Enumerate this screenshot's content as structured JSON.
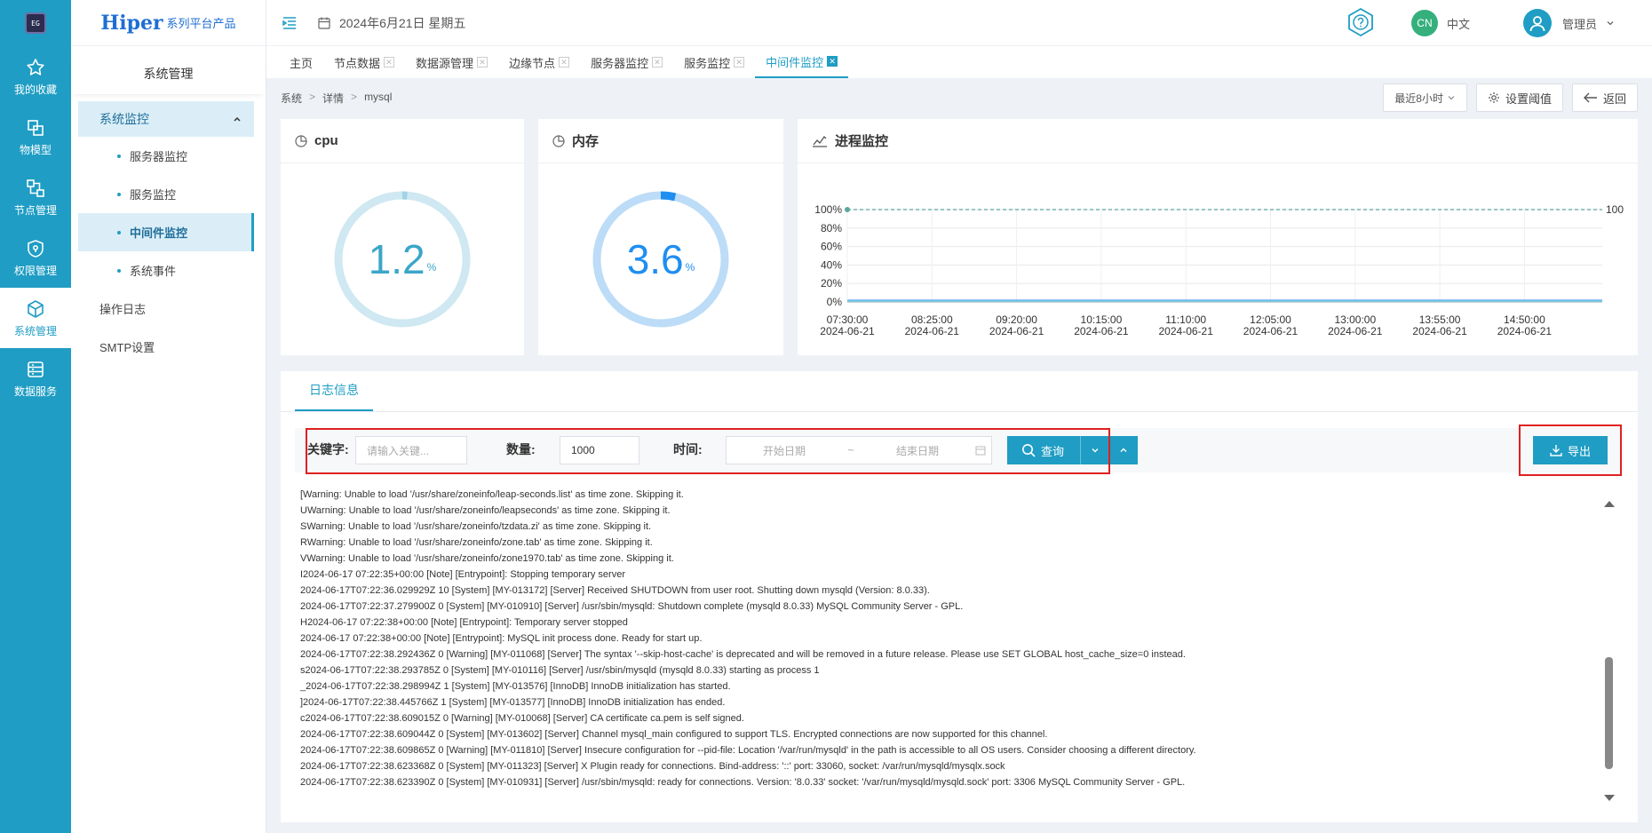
{
  "rail": {
    "logo": "EG",
    "items": [
      {
        "label": "我的收藏",
        "icon": "star-icon"
      },
      {
        "label": "物模型",
        "icon": "model-icon"
      },
      {
        "label": "节点管理",
        "icon": "node-icon"
      },
      {
        "label": "权限管理",
        "icon": "shield-icon"
      },
      {
        "label": "系统管理",
        "icon": "cube-icon",
        "active": true
      },
      {
        "label": "数据服务",
        "icon": "database-icon"
      }
    ]
  },
  "brand": {
    "name": "Hiper",
    "tagline": "系列平台产品"
  },
  "side": {
    "title": "系统管理",
    "group": "系统监控",
    "sub_items": [
      "服务器监控",
      "服务监控",
      "中间件监控",
      "系统事件"
    ],
    "active_sub": "中间件监控",
    "top_items": [
      "操作日志",
      "SMTP设置"
    ]
  },
  "header": {
    "date": "2024年6月21日 星期五",
    "lang_badge": "CN",
    "lang_label": "中文",
    "user_name": "管理员"
  },
  "tabs": [
    {
      "label": "主页",
      "closable": false
    },
    {
      "label": "节点数据",
      "closable": true
    },
    {
      "label": "数据源管理",
      "closable": true
    },
    {
      "label": "边缘节点",
      "closable": true
    },
    {
      "label": "服务器监控",
      "closable": true
    },
    {
      "label": "服务监控",
      "closable": true
    },
    {
      "label": "中间件监控",
      "closable": true,
      "active": true
    }
  ],
  "breadcrumb": [
    "系统",
    "详情",
    "mysql"
  ],
  "actions": {
    "range": "最近8小时",
    "threshold": "设置阈值",
    "back": "返回"
  },
  "cpu": {
    "title": "cpu",
    "value": "1.2",
    "unit": "%",
    "percent": 1.2,
    "color": "#9fd3e6",
    "track": "#cfe8f2",
    "text_color": "#3aa6c8"
  },
  "memory": {
    "title": "内存",
    "value": "3.6",
    "unit": "%",
    "percent": 3.6,
    "color": "#1f8ef1",
    "track": "#bcdcf7",
    "text_color": "#1f8ef1"
  },
  "process": {
    "title": "进程监控"
  },
  "chart_data": {
    "type": "line",
    "y_ticks": [
      "100%",
      "80%",
      "60%",
      "40%",
      "20%",
      "0%"
    ],
    "ylim": [
      0,
      100
    ],
    "x_ticks": [
      {
        "time": "07:30:00",
        "date": "2024-06-21"
      },
      {
        "time": "08:25:00",
        "date": "2024-06-21"
      },
      {
        "time": "09:20:00",
        "date": "2024-06-21"
      },
      {
        "time": "10:15:00",
        "date": "2024-06-21"
      },
      {
        "time": "11:10:00",
        "date": "2024-06-21"
      },
      {
        "time": "12:05:00",
        "date": "2024-06-21"
      },
      {
        "time": "13:00:00",
        "date": "2024-06-21"
      },
      {
        "time": "13:55:00",
        "date": "2024-06-21"
      },
      {
        "time": "14:50:00",
        "date": "2024-06-21"
      }
    ],
    "series": [
      {
        "values": [
          100,
          100
        ],
        "dashed": true,
        "color": "#5aa89c",
        "end_label": "100"
      },
      {
        "values": [
          1.5,
          1.5
        ],
        "color": "#1f8ef1"
      },
      {
        "values": [
          0.8,
          0.8
        ],
        "color": "#7fc9e0"
      }
    ],
    "grid": true
  },
  "log": {
    "tab": "日志信息",
    "keyword_label": "关键字:",
    "keyword_placeholder": "请输入关键...",
    "count_label": "数量:",
    "count_value": "1000",
    "time_label": "时间:",
    "start_placeholder": "开始日期",
    "range_sep": "~",
    "end_placeholder": "结束日期",
    "query": "查询",
    "export": "导出",
    "lines": [
      "[Warning: Unable to load '/usr/share/zoneinfo/leap-seconds.list' as time zone. Skipping it.",
      "UWarning: Unable to load '/usr/share/zoneinfo/leapseconds' as time zone. Skipping it.",
      "SWarning: Unable to load '/usr/share/zoneinfo/tzdata.zi' as time zone. Skipping it.",
      "RWarning: Unable to load '/usr/share/zoneinfo/zone.tab' as time zone. Skipping it.",
      "VWarning: Unable to load '/usr/share/zoneinfo/zone1970.tab' as time zone. Skipping it.",
      "I2024-06-17 07:22:35+00:00 [Note] [Entrypoint]: Stopping temporary server",
      "2024-06-17T07:22:36.029929Z 10 [System] [MY-013172] [Server] Received SHUTDOWN from user root. Shutting down mysqld (Version: 8.0.33).",
      "2024-06-17T07:22:37.279900Z 0 [System] [MY-010910] [Server] /usr/sbin/mysqld: Shutdown complete (mysqld 8.0.33) MySQL Community Server - GPL.",
      "H2024-06-17 07:22:38+00:00 [Note] [Entrypoint]: Temporary server stopped",
      "2024-06-17 07:22:38+00:00 [Note] [Entrypoint]: MySQL init process done. Ready for start up.",
      "2024-06-17T07:22:38.292436Z 0 [Warning] [MY-011068] [Server] The syntax '--skip-host-cache' is deprecated and will be removed in a future release. Please use SET GLOBAL host_cache_size=0 instead.",
      "s2024-06-17T07:22:38.293785Z 0 [System] [MY-010116] [Server] /usr/sbin/mysqld (mysqld 8.0.33) starting as process 1",
      "_2024-06-17T07:22:38.298994Z 1 [System] [MY-013576] [InnoDB] InnoDB initialization has started.",
      "]2024-06-17T07:22:38.445766Z 1 [System] [MY-013577] [InnoDB] InnoDB initialization has ended.",
      "c2024-06-17T07:22:38.609015Z 0 [Warning] [MY-010068] [Server] CA certificate ca.pem is self signed.",
      "2024-06-17T07:22:38.609044Z 0 [System] [MY-013602] [Server] Channel mysql_main configured to support TLS. Encrypted connections are now supported for this channel.",
      "2024-06-17T07:22:38.609865Z 0 [Warning] [MY-011810] [Server] Insecure configuration for --pid-file: Location '/var/run/mysqld' in the path is accessible to all OS users. Consider choosing a different directory.",
      "2024-06-17T07:22:38.623368Z 0 [System] [MY-011323] [Server] X Plugin ready for connections. Bind-address: '::' port: 33060, socket: /var/run/mysqld/mysqlx.sock",
      "2024-06-17T07:22:38.623390Z 0 [System] [MY-010931] [Server] /usr/sbin/mysqld: ready for connections. Version: '8.0.33' socket: '/var/run/mysqld/mysqld.sock' port: 3306 MySQL Community Server - GPL."
    ]
  }
}
